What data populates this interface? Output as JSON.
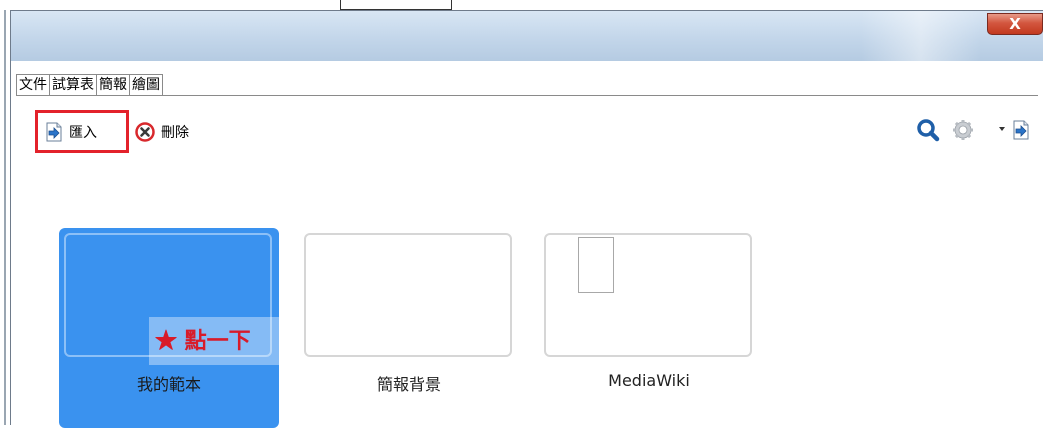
{
  "window": {
    "close_label": "X"
  },
  "tabs": [
    {
      "label": "文件",
      "active": true
    },
    {
      "label": "試算表",
      "active": false
    },
    {
      "label": "簡報",
      "active": false
    },
    {
      "label": "繪圖",
      "active": false
    }
  ],
  "toolbar": {
    "import": {
      "label": "匯入",
      "icon": "import-arrow-icon"
    },
    "delete": {
      "label": "刪除",
      "icon": "delete-circle-x-icon"
    },
    "right_icons": [
      "search-icon",
      "gear-icon",
      "dropdown-arrow-icon",
      "import-arrow-icon"
    ]
  },
  "templates": [
    {
      "label": "我的範本",
      "selected": true
    },
    {
      "label": "簡報背景",
      "selected": false
    },
    {
      "label": "MediaWiki",
      "selected": false
    }
  ],
  "annotation": {
    "text": "★ 點一下",
    "color": "#d81b2a"
  },
  "colors": {
    "selected_tile": "#3a92ef",
    "highlight_border": "#e3222b",
    "accent_blue": "#1f5fa8"
  }
}
